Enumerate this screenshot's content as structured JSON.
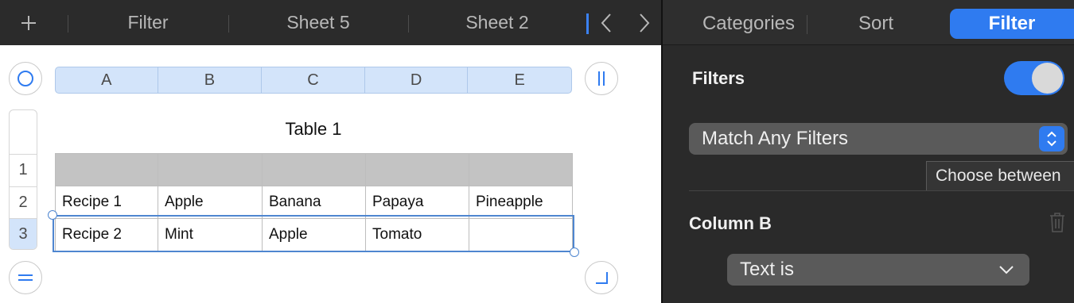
{
  "tabs": {
    "items": [
      {
        "label": "Filter"
      },
      {
        "label": "Sheet 5"
      },
      {
        "label": "Sheet 2"
      }
    ],
    "add_icon": "plus-icon",
    "prev_icon": "chevron-left-icon",
    "next_icon": "chevron-right-icon"
  },
  "spreadsheet": {
    "columns": [
      "A",
      "B",
      "C",
      "D",
      "E"
    ],
    "rows": [
      "1",
      "2",
      "3"
    ],
    "selected_row": "3",
    "table_title": "Table 1",
    "cells": [
      [
        "",
        "",
        "",
        "",
        ""
      ],
      [
        "Recipe 1",
        "Apple",
        "Banana",
        "Papaya",
        "Pineapple"
      ],
      [
        "Recipe 2",
        "Mint",
        "Apple",
        "Tomato",
        ""
      ]
    ],
    "header_row_color": "#c3c3c3",
    "selection_color": "#4e86d0"
  },
  "inspector": {
    "segments": [
      {
        "label": "Categories",
        "active": false
      },
      {
        "label": "Sort",
        "active": false
      },
      {
        "label": "Filter",
        "active": true
      }
    ],
    "filters_label": "Filters",
    "filters_enabled": true,
    "match_popup_value": "Match Any Filters",
    "tooltip_text": "Choose between",
    "column_rule_label": "Column B",
    "rule_popup_value": "Text is",
    "accent_color": "#2f7bf0"
  }
}
